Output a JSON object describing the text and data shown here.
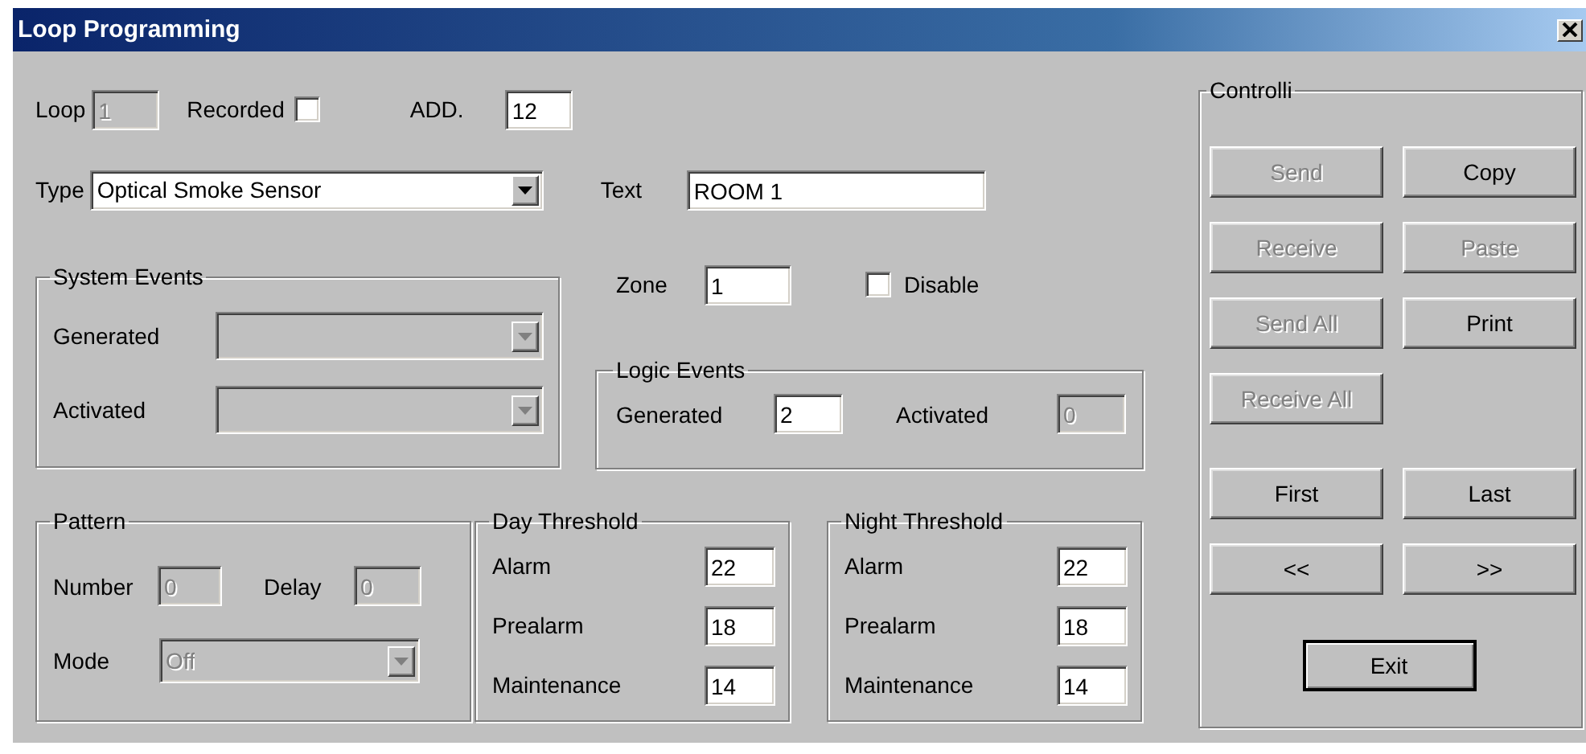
{
  "window": {
    "title": "Loop Programming"
  },
  "loop": {
    "label": "Loop",
    "value": "1",
    "disabled": true
  },
  "recorded": {
    "label": "Recorded",
    "checked": false
  },
  "address": {
    "label": "ADD.",
    "value": "12",
    "disabled": false
  },
  "type": {
    "label": "Type",
    "value": "Optical Smoke Sensor",
    "disabled": false
  },
  "text": {
    "label": "Text",
    "value": "ROOM 1",
    "disabled": false
  },
  "zone": {
    "label": "Zone",
    "value": "1",
    "disabled": false
  },
  "disable": {
    "label": "Disable",
    "checked": false
  },
  "system_events": {
    "title": "System Events",
    "rows": [
      {
        "label": "Generated",
        "disabled": true
      },
      {
        "label": "Activated",
        "disabled": true
      }
    ]
  },
  "logic_events": {
    "title": "Logic Events",
    "fields": [
      {
        "label": "Generated",
        "value": "2",
        "disabled": false
      },
      {
        "label": "Activated",
        "value": "0",
        "disabled": true
      }
    ]
  },
  "pattern": {
    "title": "Pattern",
    "number": {
      "label": "Number",
      "value": "0",
      "disabled": true
    },
    "delay": {
      "label": "Delay",
      "value": "0",
      "disabled": true
    },
    "mode": {
      "label": "Mode",
      "value": "Off",
      "disabled": true
    }
  },
  "thresholds": [
    {
      "title": "Day Threshold",
      "rows": [
        {
          "label": "Alarm",
          "value": "22",
          "disabled": false
        },
        {
          "label": "Prealarm",
          "value": "18",
          "disabled": false
        },
        {
          "label": "Maintenance",
          "value": "14",
          "disabled": false
        }
      ]
    },
    {
      "title": "Night Threshold",
      "rows": [
        {
          "label": "Alarm",
          "value": "22",
          "disabled": false
        },
        {
          "label": "Prealarm",
          "value": "18",
          "disabled": false
        },
        {
          "label": "Maintenance",
          "value": "14",
          "disabled": false
        }
      ]
    }
  ],
  "controls": {
    "title": "Controlli",
    "sections": [
      {
        "rows": [
          [
            {
              "label": "Send",
              "disabled": true
            },
            {
              "label": "Copy",
              "disabled": false
            }
          ],
          [
            {
              "label": "Receive",
              "disabled": true
            },
            {
              "label": "Paste",
              "disabled": true
            }
          ],
          [
            {
              "label": "Send All",
              "disabled": true
            },
            {
              "label": "Print",
              "disabled": false
            }
          ],
          [
            {
              "label": "Receive All",
              "disabled": true
            }
          ]
        ]
      },
      {
        "rows": [
          [
            {
              "label": "First",
              "disabled": false
            },
            {
              "label": "Last",
              "disabled": false
            }
          ],
          [
            {
              "label": "<<",
              "disabled": false
            },
            {
              "label": ">>",
              "disabled": false
            }
          ]
        ]
      },
      {
        "rows": [
          [
            {
              "label": "Exit",
              "disabled": false
            }
          ]
        ]
      }
    ]
  }
}
